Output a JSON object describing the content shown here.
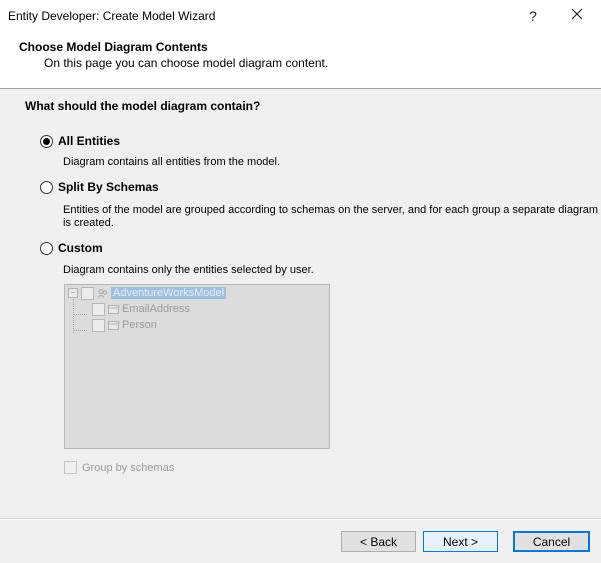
{
  "window": {
    "title": "Entity Developer: Create Model Wizard",
    "help_glyph": "?"
  },
  "header": {
    "title": "Choose Model Diagram Contents",
    "subtitle": "On this page you can choose model diagram content."
  },
  "question": "What should the model diagram contain?",
  "options": [
    {
      "label": "All Entities",
      "description": "Diagram contains all entities from the model.",
      "checked": true
    },
    {
      "label": "Split By Schemas",
      "description": "Entities of the model are grouped according to schemas on the server, and for each group a separate diagram is created.",
      "checked": false
    },
    {
      "label": "Custom",
      "description": "Diagram contains only the entities selected by user.",
      "checked": false
    }
  ],
  "tree": {
    "root": "AdventureWorksModel",
    "children": [
      "EmailAddress",
      "Person"
    ]
  },
  "group_by_schemas": "Group by schemas",
  "buttons": {
    "back": "< Back",
    "next": "Next >",
    "cancel": "Cancel"
  },
  "colors": {
    "accent": "#0078d7",
    "selection": "#9fbfe0"
  }
}
